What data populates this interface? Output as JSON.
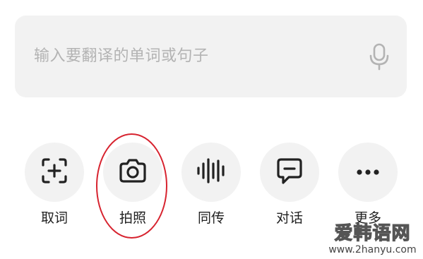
{
  "search": {
    "placeholder": "输入要翻译的单词或句子",
    "mic_icon": "microphone-icon"
  },
  "tools": [
    {
      "label": "取词",
      "icon": "capture-word-icon"
    },
    {
      "label": "拍照",
      "icon": "camera-icon"
    },
    {
      "label": "同传",
      "icon": "soundwave-icon"
    },
    {
      "label": "对话",
      "icon": "chat-bubble-icon"
    },
    {
      "label": "更多",
      "icon": "more-dots-icon"
    }
  ],
  "annotation": {
    "color": "#d7232f"
  },
  "watermark": {
    "logo": "爱韩语网",
    "url": "www.2hanyu.com"
  },
  "colors": {
    "panel_bg": "#f2f2f2",
    "icon": "#222222",
    "placeholder": "#b3b3b3"
  }
}
